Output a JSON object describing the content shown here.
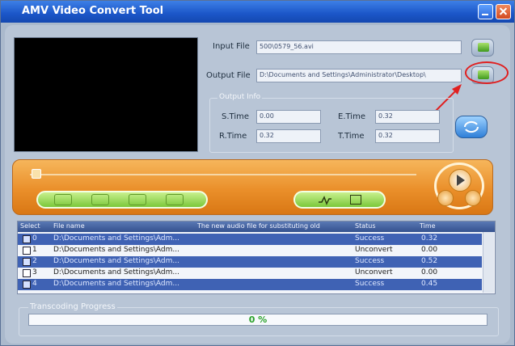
{
  "window": {
    "title": "AMV Video Convert Tool"
  },
  "io": {
    "input_label": "Input File",
    "input_value": "500\\0579_56.avi",
    "output_label": "Output File",
    "output_value": "D:\\Documents and Settings\\Administrator\\Desktop\\"
  },
  "output_info": {
    "title": "Output Info",
    "stime_label": "S.Time",
    "stime_value": "0.00",
    "etime_label": "E.Time",
    "etime_value": "0.32",
    "rtime_label": "R.Time",
    "rtime_value": "0.32",
    "ttime_label": "T.Time",
    "ttime_value": "0.32"
  },
  "table": {
    "columns": [
      "Select",
      "File name",
      "The new audio file for substituting old",
      "Status",
      "Time"
    ],
    "rows": [
      {
        "index": "0",
        "file": "D:\\Documents and Settings\\Adm...",
        "status": "Success",
        "time": "0.32",
        "checked": true
      },
      {
        "index": "1",
        "file": "D:\\Documents and Settings\\Adm...",
        "status": "Unconvert",
        "time": "0.00",
        "checked": false
      },
      {
        "index": "2",
        "file": "D:\\Documents and Settings\\Adm...",
        "status": "Success",
        "time": "0.52",
        "checked": true
      },
      {
        "index": "3",
        "file": "D:\\Documents and Settings\\Adm...",
        "status": "Unconvert",
        "time": "0.00",
        "checked": false
      },
      {
        "index": "4",
        "file": "D:\\Documents and Settings\\Adm...",
        "status": "Success",
        "time": "0.45",
        "checked": true
      }
    ]
  },
  "progress": {
    "title": "Transcoding Progress",
    "value": "0 %"
  },
  "colors": {
    "title_bar": "#1b56c8",
    "orange_panel": "#ea8f2a",
    "selected_row": "#3f62b4",
    "highlight_circle": "#e02020"
  }
}
